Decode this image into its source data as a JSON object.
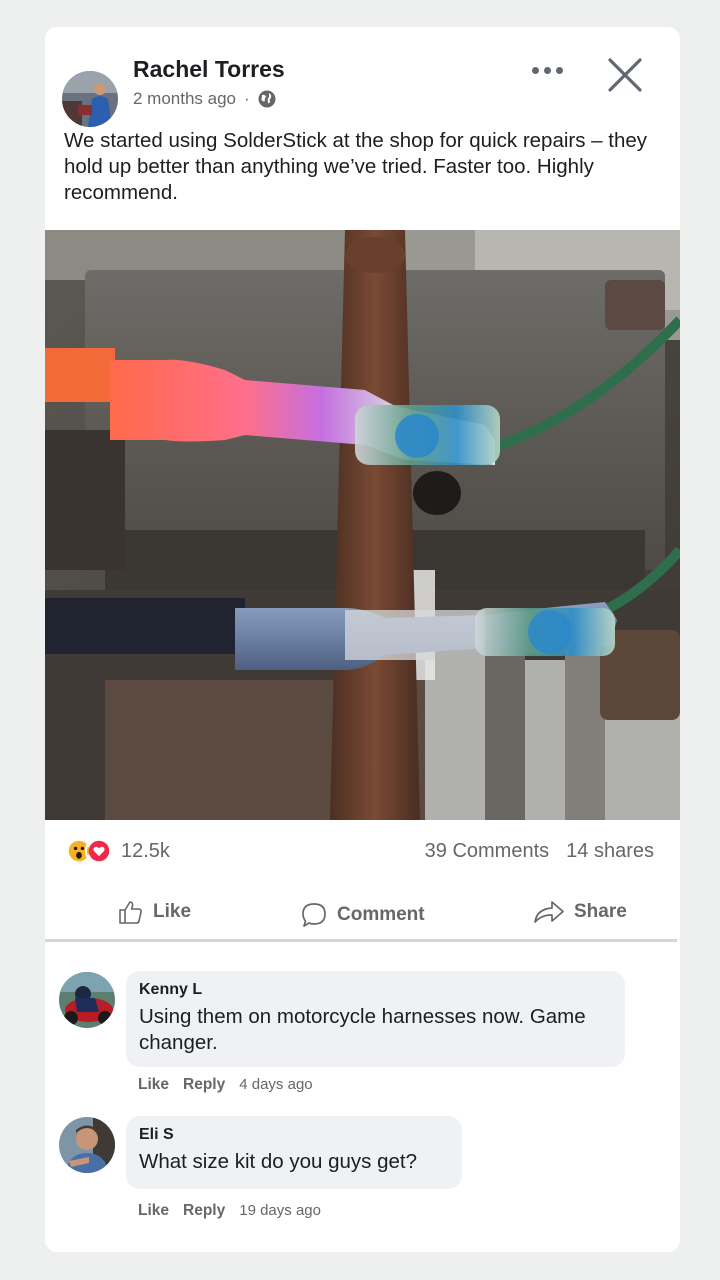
{
  "post": {
    "author": "Rachel Torres",
    "time": "2 months ago",
    "separator": "·",
    "privacy_icon": "globe-icon",
    "text": "We started using SolderStick at the shop for quick repairs – they hold up better than anything we’ve tried. Faster too. Highly recommend."
  },
  "stats": {
    "reaction_count": "12.5k",
    "reaction_icons": [
      "wow-icon",
      "love-icon"
    ],
    "comments": "39 Comments",
    "shares": "14 shares"
  },
  "actions": {
    "like": "Like",
    "comment": "Comment",
    "share": "Share"
  },
  "comments": [
    {
      "name": "Kenny L",
      "text": "Using them on motorcycle harnesses now. Game changer.",
      "like": "Like",
      "reply": "Reply",
      "time": "4 days ago"
    },
    {
      "name": "Eli S",
      "text": "What size kit do you guys get?",
      "like": "Like",
      "reply": "Reply",
      "time": "19 days ago"
    }
  ],
  "colors": {
    "accent_text": "#65676b",
    "love": "#f02849",
    "wow": "#f7b125"
  }
}
